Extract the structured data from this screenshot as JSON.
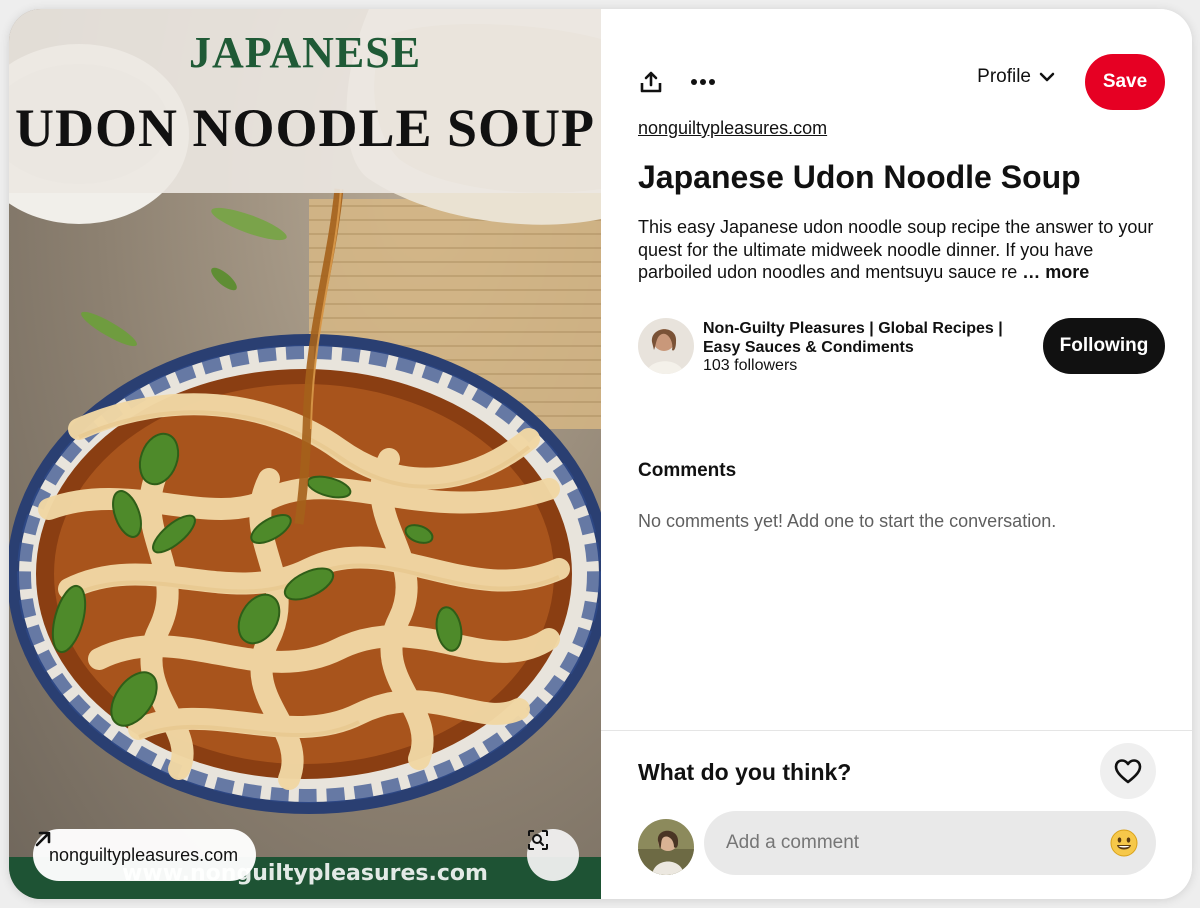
{
  "pin_image": {
    "title_top": "JAPANESE",
    "title_main": "UDON NOODLE SOUP",
    "watermark": "www.nonguiltypleasures.com",
    "source_pill_label": "nonguiltypleasures.com",
    "arrow_icon": "arrow-up-right-icon",
    "lens_icon": "visual-search-icon"
  },
  "toolbar": {
    "share_icon": "share-icon",
    "more_icon": "more-icon",
    "profile_label": "Profile",
    "save_label": "Save"
  },
  "pin": {
    "source_link": "nonguiltypleasures.com",
    "title": "Japanese Udon Noodle Soup",
    "description": "This easy Japanese udon noodle soup recipe the answer to your quest for the ultimate midweek noodle dinner. If you have parboiled udon noodles and mentsuyu sauce re",
    "more_label": "… more"
  },
  "creator": {
    "name": "Non-Guilty Pleasures | Global Recipes | Easy Sauces & Condiments",
    "followers": "103 followers",
    "follow_label": "Following"
  },
  "comments": {
    "heading": "Comments",
    "empty_text": "No comments yet! Add one to start the conversation.",
    "prompt": "What do you think?",
    "input_placeholder": "Add a comment"
  },
  "colors": {
    "save": "#e60023",
    "following": "#111111",
    "image_banner_text": "#1f5a36",
    "image_footer": "#1e5334"
  }
}
